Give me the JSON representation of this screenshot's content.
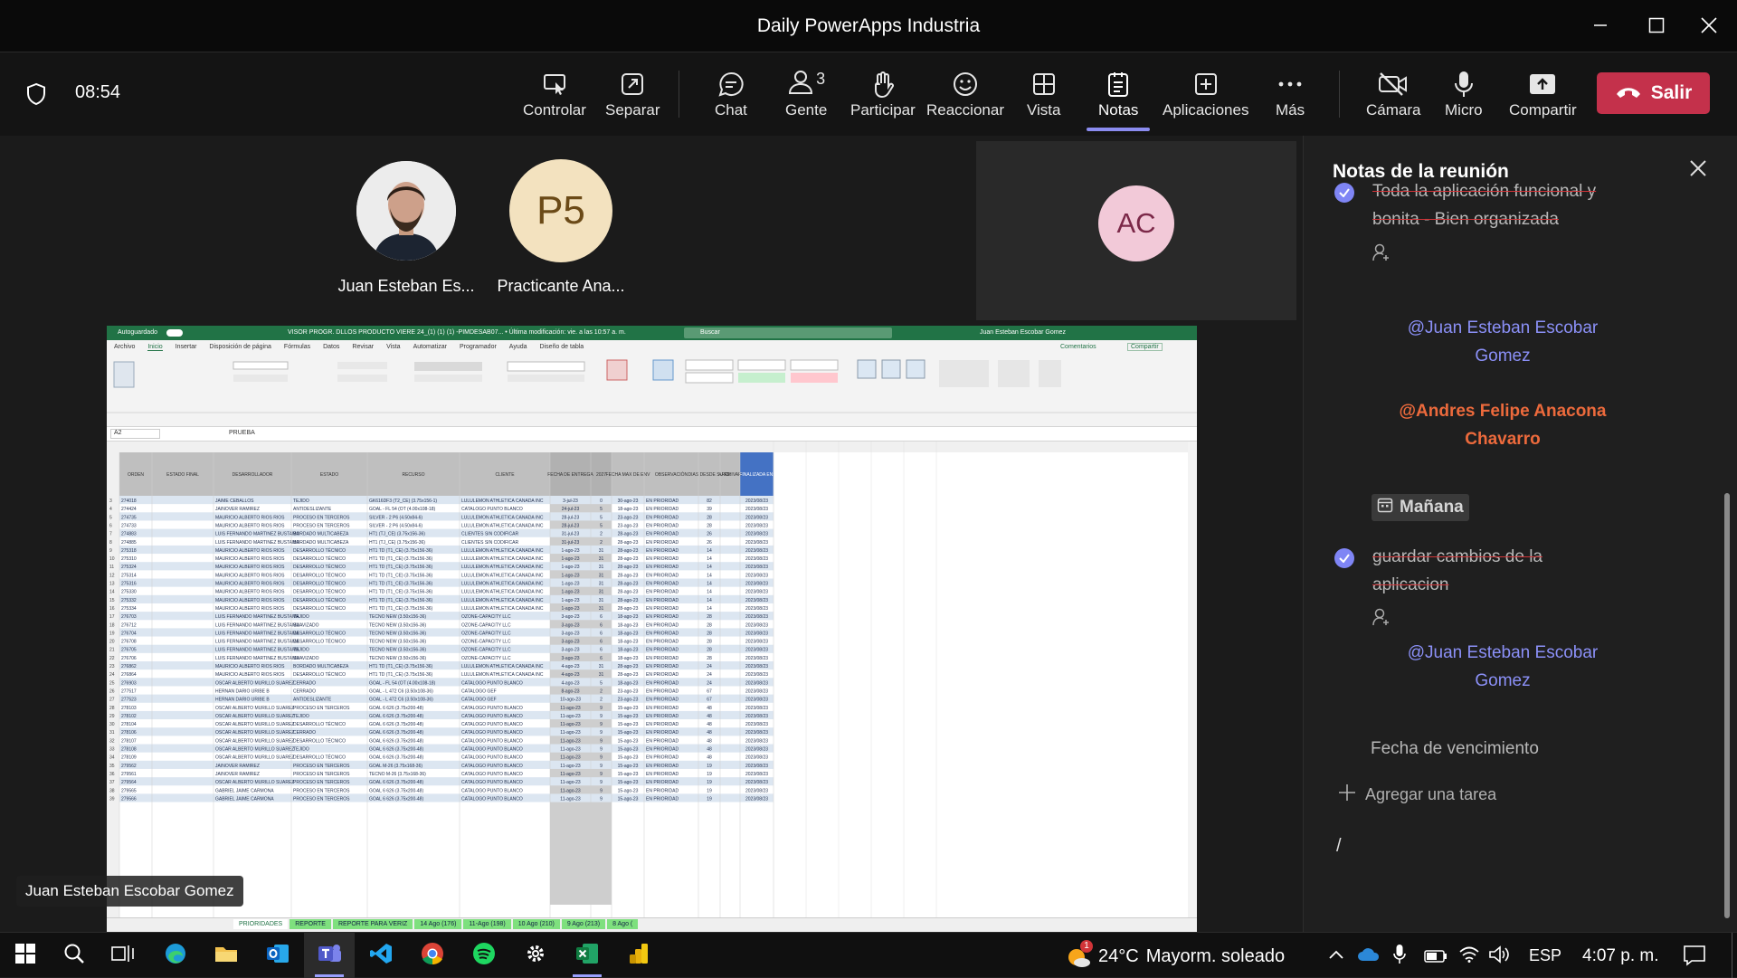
{
  "window": {
    "title": "Daily PowerApps Industria"
  },
  "meeting": {
    "timer": "08:54",
    "toolbar": {
      "controlar": "Controlar",
      "separar": "Separar",
      "chat": "Chat",
      "gente": "Gente",
      "gente_count": "3",
      "participar": "Participar",
      "reaccionar": "Reaccionar",
      "vista": "Vista",
      "notas": "Notas",
      "aplicaciones": "Aplicaciones",
      "mas": "Más",
      "camara": "Cámara",
      "micro": "Micro",
      "compartir": "Compartir",
      "salir": "Salir"
    },
    "participants": [
      {
        "name": "Juan Esteban Es...",
        "initials": ""
      },
      {
        "name": "Practicante Ana...",
        "initials": "P5"
      }
    ],
    "tile_initials": "AC",
    "presenter_label": "Juan Esteban Escobar Gomez"
  },
  "excel": {
    "title": "VISOR PROGR. DLLOS PRODUCTO VIERE 24_(1) (1) (1) -PIMDESAB07... • Última modificación: vie. a las 10:57 a. m.",
    "user": "Juan Esteban Escobar Gomez",
    "autosave": "Autoguardado",
    "search": "Buscar",
    "menu": [
      "Archivo",
      "Inicio",
      "Insertar",
      "Disposición de página",
      "Fórmulas",
      "Datos",
      "Revisar",
      "Vista",
      "Automatizar",
      "Programador",
      "Ayuda",
      "Diseño de tabla"
    ],
    "comentarios": "Comentarios",
    "compartir": "Compartir",
    "cell_ref": "A2",
    "formula": "PRUEBA",
    "headers": [
      "ORDEN",
      "ESTADO FINAL",
      "DESARROLLADOR",
      "ESTADO",
      "RECURSO",
      "CLIENTE",
      "FECHA DE ENTREGA",
      "2027",
      "FECHA MAX DE ENVIO",
      "OBSERVACIÓN",
      "DIAS DESDE SU REGISTRO",
      "ARCHIVAR",
      "FINALIZADA EN:"
    ],
    "rows": [
      [
        "274018",
        "JAIME CEBALLOS",
        "TEJIDO",
        "GK616DF3 (T2_CE) (3.75x156-1)",
        "LULULEMON ATHLETICA CANADA INC",
        "3-jul-23",
        "0",
        "30-ago-23",
        "EN PRIORIDAD",
        "82",
        "2023/08/23"
      ],
      [
        "274424",
        "JAINOVER RAMIREZ",
        "ANTIDESLIZANTE",
        "GOAL - FL 54 (OT (4.00x108-18)",
        "CATALOGO PUNTO BLANCO",
        "24-jul-23",
        "5",
        "18-ago-23",
        "EN PRIORIDAD",
        "39",
        "2023/08/23"
      ],
      [
        "274735",
        "MAURICIO ALBERTO RIOS RIOS",
        "PROCESO EN TERCEROS",
        "SILVER - 2 P6 (4.50x84-6)",
        "LULULEMON ATHLETICA CANADA INC",
        "28-jul-23",
        "5",
        "23-ago-23",
        "EN PRIORIDAD",
        "28",
        "2023/08/23"
      ],
      [
        "274733",
        "MAURICIO ALBERTO RIOS RIOS",
        "PROCESO EN TERCEROS",
        "SILVER - 2 P6 (4.50x84-6)",
        "LULULEMON ATHLETICA CANADA INC",
        "28-jul-23",
        "5",
        "23-ago-23",
        "EN PRIORIDAD",
        "28",
        "2023/08/23"
      ],
      [
        "274883",
        "LUIS FERNANDO MARTINEZ BUSTAMA",
        "BORDADO MULTICABEZA",
        "HT1 (TJ_CE) (3.75x156-36)",
        "CLIENTES SIN CODIFICAR",
        "31-jul-23",
        "2",
        "28-ago-23",
        "EN PRIORIDAD",
        "26",
        "2023/08/23"
      ],
      [
        "274885",
        "LUIS FERNANDO MARTINEZ BUSTAMA",
        "BORDADO MULTICABEZA",
        "HT1 (TJ_CE) (3.75x156-36)",
        "CLIENTES SIN CODIFICAR",
        "31-jul-23",
        "2",
        "28-ago-23",
        "EN PRIORIDAD",
        "26",
        "2023/08/23"
      ],
      [
        "275318",
        "MAURICIO ALBERTO RIOS RIOS",
        "DESARROLLO TÉCNICO",
        "HT1 TD (T1_CE) (3.75x156-36)",
        "LULULEMON ATHLETICA CANADA INC",
        "1-ago-23",
        "31",
        "28-ago-23",
        "EN PRIORIDAD",
        "14",
        "2023/08/23"
      ],
      [
        "275310",
        "MAURICIO ALBERTO RIOS RIOS",
        "DESARROLLO TÉCNICO",
        "HT1 TD (T1_CE) (3.75x156-36)",
        "LULULEMON ATHLETICA CANADA INC",
        "1-ago-23",
        "31",
        "28-ago-23",
        "EN PRIORIDAD",
        "14",
        "2023/08/23"
      ],
      [
        "275324",
        "MAURICIO ALBERTO RIOS RIOS",
        "DESARROLLO TÉCNICO",
        "HT1 TD (T1_CE) (3.75x156-36)",
        "LULULEMON ATHLETICA CANADA INC",
        "1-ago-23",
        "31",
        "28-ago-23",
        "EN PRIORIDAD",
        "14",
        "2023/08/23"
      ],
      [
        "275314",
        "MAURICIO ALBERTO RIOS RIOS",
        "DESARROLLO TÉCNICO",
        "HT1 TD (T1_CE) (3.75x156-36)",
        "LULULEMON ATHLETICA CANADA INC",
        "1-ago-23",
        "31",
        "28-ago-23",
        "EN PRIORIDAD",
        "14",
        "2023/08/23"
      ],
      [
        "275316",
        "MAURICIO ALBERTO RIOS RIOS",
        "DESARROLLO TÉCNICO",
        "HT1 TD (T1_CE) (3.75x156-36)",
        "LULULEMON ATHLETICA CANADA INC",
        "1-ago-23",
        "31",
        "28-ago-23",
        "EN PRIORIDAD",
        "14",
        "2023/08/23"
      ],
      [
        "275330",
        "MAURICIO ALBERTO RIOS RIOS",
        "DESARROLLO TÉCNICO",
        "HT1 TD (T1_CE) (3.75x156-36)",
        "LULULEMON ATHLETICA CANADA INC",
        "1-ago-23",
        "31",
        "28-ago-23",
        "EN PRIORIDAD",
        "14",
        "2023/08/23"
      ],
      [
        "275332",
        "MAURICIO ALBERTO RIOS RIOS",
        "DESARROLLO TÉCNICO",
        "HT1 TD (T1_CE) (3.75x156-36)",
        "LULULEMON ATHLETICA CANADA INC",
        "1-ago-23",
        "31",
        "28-ago-23",
        "EN PRIORIDAD",
        "14",
        "2023/08/23"
      ],
      [
        "275334",
        "MAURICIO ALBERTO RIOS RIOS",
        "DESARROLLO TÉCNICO",
        "HT1 TD (T1_CE) (3.75x156-36)",
        "LULULEMON ATHLETICA CANADA INC",
        "1-ago-23",
        "31",
        "28-ago-23",
        "EN PRIORIDAD",
        "14",
        "2023/08/23"
      ],
      [
        "276703",
        "LUIS FERNANDO MARTINEZ BUSTAMA",
        "TEJIDO",
        "TECNO NEW (3.50x156-36)",
        "OZONE-CAPACITY LLC",
        "3-ago-23",
        "6",
        "18-ago-23",
        "EN PRIORIDAD",
        "28",
        "2023/08/23"
      ],
      [
        "276712",
        "LUIS FERNANDO MARTINEZ BUSTAMA",
        "SUAVIZADO",
        "TECNO NEW (3.50x156-36)",
        "OZONE-CAPACITY LLC",
        "3-ago-23",
        "6",
        "18-ago-23",
        "EN PRIORIDAD",
        "28",
        "2023/08/23"
      ],
      [
        "276704",
        "LUIS FERNANDO MARTINEZ BUSTAMA",
        "DESARROLLO TÉCNICO",
        "TECNO NEW (3.50x156-36)",
        "OZONE-CAPACITY LLC",
        "3-ago-23",
        "6",
        "18-ago-23",
        "EN PRIORIDAD",
        "28",
        "2023/08/23"
      ],
      [
        "276708",
        "LUIS FERNANDO MARTINEZ BUSTAMA",
        "DESARROLLO TÉCNICO",
        "TECNO NEW (3.50x156-36)",
        "OZONE-CAPACITY LLC",
        "3-ago-23",
        "6",
        "18-ago-23",
        "EN PRIORIDAD",
        "28",
        "2023/08/23"
      ],
      [
        "276705",
        "LUIS FERNANDO MARTINEZ BUSTAMA",
        "TEJIDO",
        "TECNO NEW (3.50x156-36)",
        "OZONE-CAPACITY LLC",
        "3-ago-23",
        "6",
        "18-ago-23",
        "EN PRIORIDAD",
        "28",
        "2023/08/23"
      ],
      [
        "276706",
        "LUIS FERNANDO MARTINEZ BUSTAMA",
        "SUAVIZADO",
        "TECNO NEW (3.50x156-36)",
        "OZONE-CAPACITY LLC",
        "3-ago-23",
        "6",
        "18-ago-23",
        "EN PRIORIDAD",
        "28",
        "2023/08/23"
      ],
      [
        "276862",
        "MAURICIO ALBERTO RIOS RIOS",
        "BORDADO MULTICABEZA",
        "HT1 TD (T1_CE) (3.75x156-36)",
        "LULULEMON ATHLETICA CANADA INC",
        "4-ago-23",
        "31",
        "28-ago-23",
        "EN PRIORIDAD",
        "24",
        "2023/08/23"
      ],
      [
        "276864",
        "MAURICIO ALBERTO RIOS RIOS",
        "DESARROLLO TÉCNICO",
        "HT1 TD (T1_CE) (3.75x156-36)",
        "LULULEMON ATHLETICA CANADA INC",
        "4-ago-23",
        "31",
        "28-ago-23",
        "EN PRIORIDAD",
        "24",
        "2023/08/23"
      ],
      [
        "276903",
        "OSCAR ALBERTO MURILLO SUAREZ",
        "CERRADO",
        "GOAL - FL 54 (OT (4.00x108-18)",
        "CATALOGO PUNTO BLANCO",
        "4-ago-23",
        "5",
        "18-ago-23",
        "EN PRIORIDAD",
        "24",
        "2023/08/23"
      ],
      [
        "277517",
        "HERNAN DARIO URIBE B",
        "CERRADO",
        "GOAL - L 472 C6 (3.50x108-36)",
        "CATALOGO GEF",
        "8-ago-23",
        "2",
        "23-ago-23",
        "EN PRIORIDAD",
        "67",
        "2023/08/23"
      ],
      [
        "277523",
        "HERNAN DARIO URIBE B",
        "ANTIDESLIZANTE",
        "GOAL - L 472 C6 (3.50x108-36)",
        "CATALOGO GEF",
        "10-ago-23",
        "2",
        "23-ago-23",
        "EN PRIORIDAD",
        "67",
        "2023/08/23"
      ],
      [
        "278103",
        "OSCAR ALBERTO MURILLO SUAREZ",
        "PROCESO EN TERCEROS",
        "GOAL 6 626 (3.75x200-48)",
        "CATALOGO PUNTO BLANCO",
        "11-ago-23",
        "9",
        "15-ago-23",
        "EN PRIORIDAD",
        "48",
        "2023/08/23"
      ],
      [
        "278102",
        "OSCAR ALBERTO MURILLO SUAREZ",
        "TEJIDO",
        "GOAL 6 626 (3.75x200-48)",
        "CATALOGO PUNTO BLANCO",
        "11-ago-23",
        "9",
        "15-ago-23",
        "EN PRIORIDAD",
        "48",
        "2023/08/23"
      ],
      [
        "278104",
        "OSCAR ALBERTO MURILLO SUAREZ",
        "DESARROLLO TÉCNICO",
        "GOAL 6 626 (3.75x200-48)",
        "CATALOGO PUNTO BLANCO",
        "11-ago-23",
        "9",
        "15-ago-23",
        "EN PRIORIDAD",
        "48",
        "2023/08/23"
      ],
      [
        "278106",
        "OSCAR ALBERTO MURILLO SUAREZ",
        "CERRADO",
        "GOAL 6 626 (3.75x200-48)",
        "CATALOGO PUNTO BLANCO",
        "11-ago-23",
        "9",
        "15-ago-23",
        "EN PRIORIDAD",
        "48",
        "2023/08/23"
      ],
      [
        "278107",
        "OSCAR ALBERTO MURILLO SUAREZ",
        "DESARROLLO TÉCNICO",
        "GOAL 6 626 (3.75x200-48)",
        "CATALOGO PUNTO BLANCO",
        "11-ago-23",
        "9",
        "15-ago-23",
        "EN PRIORIDAD",
        "48",
        "2023/08/23"
      ],
      [
        "278108",
        "OSCAR ALBERTO MURILLO SUAREZ",
        "TEJIDO",
        "GOAL 6 626 (3.75x200-48)",
        "CATALOGO PUNTO BLANCO",
        "11-ago-23",
        "9",
        "15-ago-23",
        "EN PRIORIDAD",
        "48",
        "2023/08/23"
      ],
      [
        "278109",
        "OSCAR ALBERTO MURILLO SUAREZ",
        "DESARROLLO TÉCNICO",
        "GOAL 6 626 (3.75x200-48)",
        "CATALOGO PUNTO BLANCO",
        "11-ago-23",
        "9",
        "15-ago-23",
        "EN PRIORIDAD",
        "48",
        "2023/08/23"
      ],
      [
        "279562",
        "JAINOVER RAMIREZ",
        "PROCESO EN TERCEROS",
        "GOAL M-26 (3.75x168-36)",
        "CATALOGO PUNTO BLANCO",
        "11-ago-23",
        "9",
        "15-ago-23",
        "EN PRIORIDAD",
        "19",
        "2023/08/23"
      ],
      [
        "279561",
        "JAINOVER RAMIREZ",
        "PROCESO EN TERCEROS",
        "TECNO M-26 (3.75x168-36)",
        "CATALOGO PUNTO BLANCO",
        "11-ago-23",
        "9",
        "15-ago-23",
        "EN PRIORIDAD",
        "19",
        "2023/08/23"
      ],
      [
        "279564",
        "OSCAR ALBERTO MURILLO SUAREZ",
        "PROCESO EN TERCEROS",
        "GOAL 6 626 (3.75x200-48)",
        "CATALOGO PUNTO BLANCO",
        "11-ago-23",
        "9",
        "15-ago-23",
        "EN PRIORIDAD",
        "19",
        "2023/08/23"
      ],
      [
        "279565",
        "GABRIEL JAIME CARMONA",
        "PROCESO EN TERCEROS",
        "GOAL 6 626 (3.75x200-48)",
        "CATALOGO PUNTO BLANCO",
        "11-ago-23",
        "9",
        "15-ago-23",
        "EN PRIORIDAD",
        "19",
        "2023/08/23"
      ],
      [
        "279566",
        "GABRIEL JAIME CARMONA",
        "PROCESO EN TERCEROS",
        "GOAL 6 626 (3.75x200-48)",
        "CATALOGO PUNTO BLANCO",
        "11-ago-23",
        "9",
        "15-ago-23",
        "EN PRIORIDAD",
        "19",
        "2023/08/23"
      ]
    ],
    "sheet_tabs": [
      "PRIORIDADES",
      "REPORTE",
      "REPORTE PARA VERIZ",
      "14 Ago (176)",
      "11-Ago (198)",
      "10 Ago (210)",
      "9 Ago (213)",
      "8 Ago ("
    ]
  },
  "notes": {
    "title": "Notas de la reunión",
    "task1": "Toda la aplicación funcional y bonita - Bien organizada",
    "mention1": "@Juan Esteban Escobar Gomez",
    "mention_red": "@Andres Felipe Anacona Chavarro",
    "manana": "Mañana",
    "task2": "guardar cambios de la aplicacion",
    "mention2": "@Juan Esteban Escobar Gomez",
    "due_label": "Fecha de vencimiento",
    "add_task": "Agregar una tarea",
    "slash": "/"
  },
  "taskbar": {
    "temperature": "24°C",
    "weather": "Mayorm. soleado",
    "weather_badge": "1",
    "lang": "ESP",
    "time": "4:07 p. m."
  },
  "colors": {
    "accent": "#7f85f5",
    "leave": "#c4314b",
    "mention": "#8b90f7",
    "mention_red": "#ec6a3c",
    "excel_green": "#217346"
  }
}
